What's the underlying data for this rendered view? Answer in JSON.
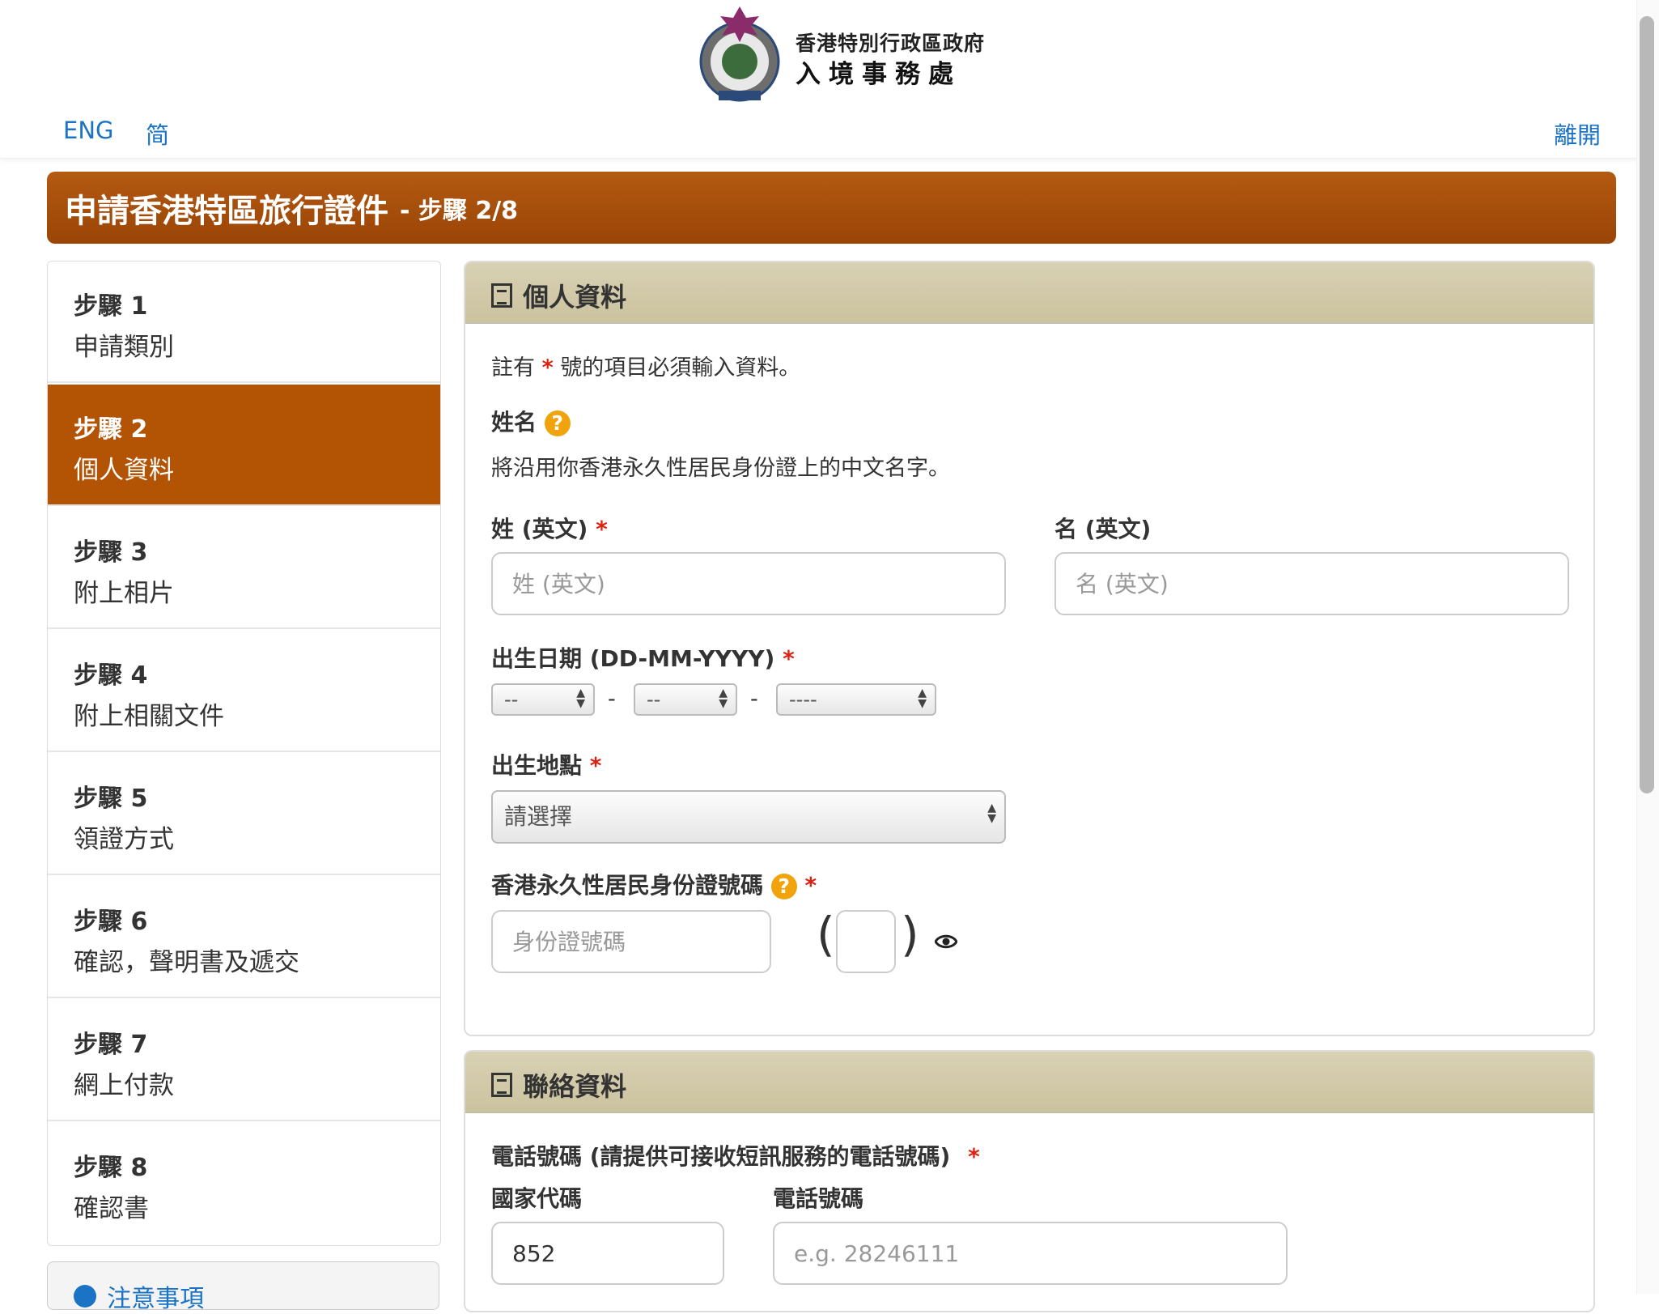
{
  "header": {
    "org_line1": "香港特別行政區政府",
    "org_line2": "入境事務處",
    "lang_eng": "ENG",
    "lang_sc": "简",
    "exit": "離開"
  },
  "banner": {
    "title": "申請香港特區旅行證件",
    "step": "- 步驟 2/8"
  },
  "steps": [
    {
      "num": "步驟 1",
      "label": "申請類別",
      "active": false
    },
    {
      "num": "步驟 2",
      "label": "個人資料",
      "active": true
    },
    {
      "num": "步驟 3",
      "label": "附上相片",
      "active": false
    },
    {
      "num": "步驟 4",
      "label": "附上相關文件",
      "active": false
    },
    {
      "num": "步驟 5",
      "label": "領證方式",
      "active": false
    },
    {
      "num": "步驟 6",
      "label": "確認，聲明書及遞交",
      "active": false
    },
    {
      "num": "步驟 7",
      "label": "網上付款",
      "active": false
    },
    {
      "num": "步驟 8",
      "label": "確認書",
      "active": false
    }
  ],
  "notice": "注意事項",
  "personal": {
    "title": "個人資料",
    "req_note_pre": "註有",
    "req_star": "*",
    "req_note_post": "號的項目必須輸入資料。",
    "name_label": "姓名",
    "name_hint": "將沿用你香港永久性居民身份證上的中文名字。",
    "surname_label": "姓 (英文)",
    "surname_placeholder": "姓 (英文)",
    "given_label": "名 (英文)",
    "given_placeholder": "名 (英文)",
    "dob_label": "出生日期 (DD-MM-YYYY)",
    "dob_day": "--",
    "dob_month": "--",
    "dob_year": "----",
    "dash": "-",
    "pob_label": "出生地點",
    "pob_value": "請選擇",
    "hkid_label": "香港永久性居民身份證號碼",
    "hkid_placeholder": "身份證號碼",
    "paren_open": "(",
    "paren_close": ")"
  },
  "contact": {
    "title": "聯絡資料",
    "phone_label": "電話號碼 (請提供可接收短訊服務的電話號碼)",
    "country_code_label": "國家代碼",
    "country_code_value": "852",
    "phone_number_label": "電話號碼",
    "phone_placeholder": "e.g. 28246111"
  },
  "colors": {
    "accent": "#b25404",
    "link": "#1a73c4",
    "required": "#dd2211",
    "help": "#f0a30a"
  }
}
